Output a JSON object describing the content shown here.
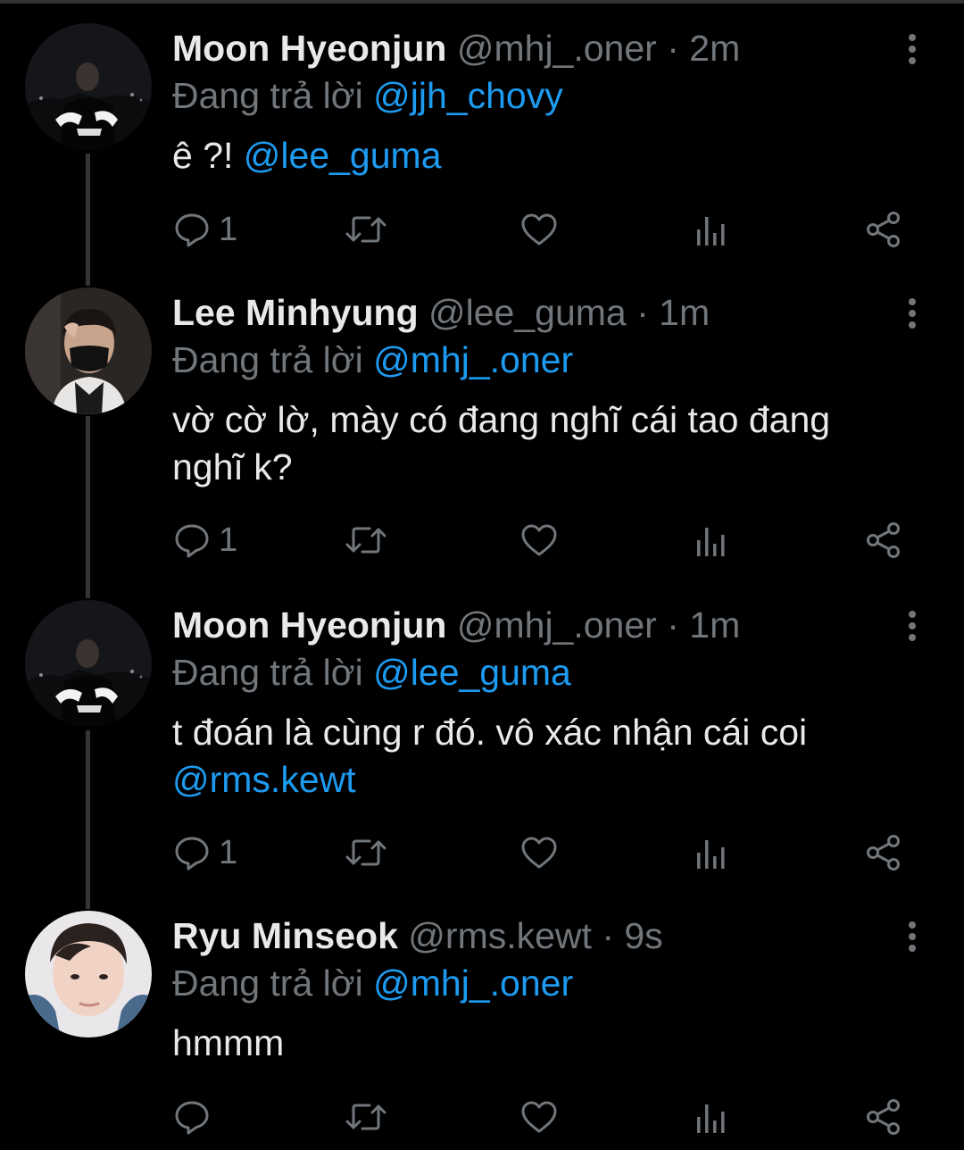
{
  "colors": {
    "background": "#000000",
    "text": "#e7e9ea",
    "secondary": "#71767b",
    "link": "#1d9bf0",
    "thread_line": "#333639"
  },
  "reply_prefix": "Đang trả lời",
  "tweets": [
    {
      "name": "Moon Hyeonjun",
      "handle": "@mhj_.oner",
      "time": "· 2m",
      "replying_to": "@jjh_chovy",
      "text": "ê ?!",
      "mention": "@lee_guma",
      "reply_count": "1",
      "icons": [
        "more-vertical-icon",
        "reply-icon",
        "retweet-icon",
        "like-icon",
        "analytics-icon",
        "share-icon"
      ]
    },
    {
      "name": "Lee Minhyung",
      "handle": "@lee_guma",
      "time": "· 1m",
      "replying_to": "@mhj_.oner",
      "text_line1": "vờ cờ lờ, mày có đang nghĩ cái tao đang",
      "text_line2": "nghĩ k?",
      "reply_count": "1"
    },
    {
      "name": "Moon Hyeonjun",
      "handle": "@mhj_.oner",
      "time": "· 1m",
      "replying_to": "@lee_guma",
      "text_line1": "t đoán là cùng r đó. vô xác nhận cái coi",
      "mention": "@rms.kewt",
      "reply_count": "1"
    },
    {
      "name": "Ryu Minseok",
      "handle": "@rms.kewt",
      "time": "· 9s",
      "replying_to": "@mhj_.oner",
      "text": "hmmm",
      "reply_count": ""
    }
  ]
}
